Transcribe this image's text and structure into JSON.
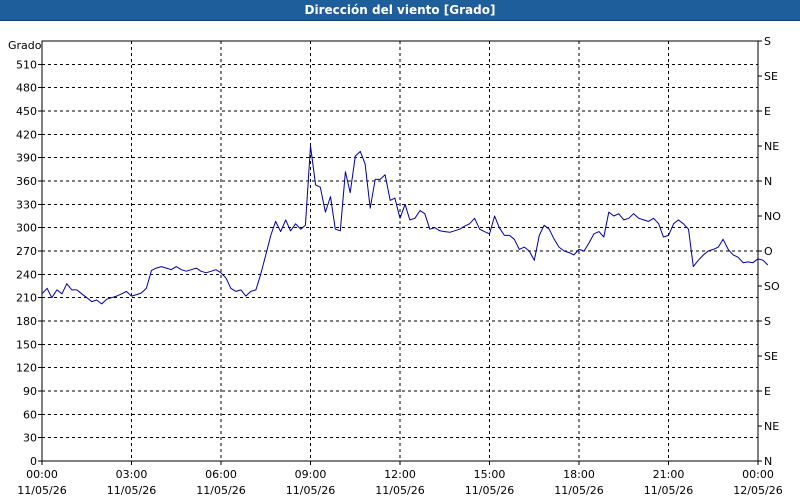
{
  "title": "Dirección del viento [Grado]",
  "chart_data": {
    "type": "line",
    "title": "Dirección del viento [Grado]",
    "ylabel": "Grado",
    "ylim": [
      0,
      540
    ],
    "yticks": [
      0,
      30,
      60,
      90,
      120,
      150,
      180,
      210,
      240,
      270,
      300,
      330,
      360,
      390,
      420,
      450,
      480,
      510
    ],
    "y2ticks": [
      {
        "v": 0,
        "label": "N"
      },
      {
        "v": 45,
        "label": "NE"
      },
      {
        "v": 90,
        "label": "E"
      },
      {
        "v": 135,
        "label": "SE"
      },
      {
        "v": 180,
        "label": "S"
      },
      {
        "v": 225,
        "label": "SO"
      },
      {
        "v": 270,
        "label": "O"
      },
      {
        "v": 315,
        "label": "NO"
      },
      {
        "v": 360,
        "label": "N"
      },
      {
        "v": 405,
        "label": "NE"
      },
      {
        "v": 450,
        "label": "E"
      },
      {
        "v": 495,
        "label": "SE"
      },
      {
        "v": 540,
        "label": "S"
      }
    ],
    "xlim": [
      0,
      24
    ],
    "xticks": [
      {
        "v": 0,
        "time": "00:00",
        "date": "11/05/26"
      },
      {
        "v": 3,
        "time": "03:00",
        "date": "11/05/26"
      },
      {
        "v": 6,
        "time": "06:00",
        "date": "11/05/26"
      },
      {
        "v": 9,
        "time": "09:00",
        "date": "11/05/26"
      },
      {
        "v": 12,
        "time": "12:00",
        "date": "11/05/26"
      },
      {
        "v": 15,
        "time": "15:00",
        "date": "11/05/26"
      },
      {
        "v": 18,
        "time": "18:00",
        "date": "11/05/26"
      },
      {
        "v": 21,
        "time": "21:00",
        "date": "11/05/26"
      },
      {
        "v": 24,
        "time": "00:00",
        "date": "12/05/26"
      }
    ],
    "grid": true,
    "series": [
      {
        "color": "#00009c",
        "points": [
          [
            0.0,
            215
          ],
          [
            0.17,
            222
          ],
          [
            0.33,
            210
          ],
          [
            0.5,
            220
          ],
          [
            0.67,
            215
          ],
          [
            0.83,
            228
          ],
          [
            1.0,
            220
          ],
          [
            1.17,
            220
          ],
          [
            1.33,
            215
          ],
          [
            1.5,
            210
          ],
          [
            1.67,
            205
          ],
          [
            1.83,
            207
          ],
          [
            2.0,
            202
          ],
          [
            2.17,
            208
          ],
          [
            2.33,
            210
          ],
          [
            2.5,
            212
          ],
          [
            2.67,
            215
          ],
          [
            2.83,
            218
          ],
          [
            3.0,
            212
          ],
          [
            3.17,
            214
          ],
          [
            3.33,
            216
          ],
          [
            3.5,
            222
          ],
          [
            3.67,
            245
          ],
          [
            3.83,
            248
          ],
          [
            4.0,
            250
          ],
          [
            4.17,
            248
          ],
          [
            4.33,
            246
          ],
          [
            4.5,
            250
          ],
          [
            4.67,
            246
          ],
          [
            4.83,
            244
          ],
          [
            5.0,
            246
          ],
          [
            5.17,
            248
          ],
          [
            5.33,
            244
          ],
          [
            5.5,
            242
          ],
          [
            5.67,
            244
          ],
          [
            5.83,
            246
          ],
          [
            6.0,
            242
          ],
          [
            6.17,
            235
          ],
          [
            6.33,
            222
          ],
          [
            6.5,
            218
          ],
          [
            6.67,
            220
          ],
          [
            6.83,
            212
          ],
          [
            7.0,
            218
          ],
          [
            7.17,
            220
          ],
          [
            7.33,
            240
          ],
          [
            7.5,
            265
          ],
          [
            7.67,
            290
          ],
          [
            7.83,
            308
          ],
          [
            8.0,
            295
          ],
          [
            8.17,
            310
          ],
          [
            8.33,
            296
          ],
          [
            8.5,
            305
          ],
          [
            8.67,
            298
          ],
          [
            8.83,
            303
          ],
          [
            9.0,
            405
          ],
          [
            9.17,
            355
          ],
          [
            9.33,
            352
          ],
          [
            9.5,
            320
          ],
          [
            9.67,
            340
          ],
          [
            9.83,
            298
          ],
          [
            10.0,
            296
          ],
          [
            10.17,
            372
          ],
          [
            10.33,
            345
          ],
          [
            10.5,
            392
          ],
          [
            10.67,
            398
          ],
          [
            10.83,
            382
          ],
          [
            11.0,
            325
          ],
          [
            11.17,
            362
          ],
          [
            11.33,
            362
          ],
          [
            11.5,
            368
          ],
          [
            11.67,
            335
          ],
          [
            11.83,
            338
          ],
          [
            12.0,
            312
          ],
          [
            12.17,
            330
          ],
          [
            12.33,
            310
          ],
          [
            12.5,
            312
          ],
          [
            12.67,
            322
          ],
          [
            12.83,
            318
          ],
          [
            13.0,
            298
          ],
          [
            13.17,
            300
          ],
          [
            13.33,
            296
          ],
          [
            13.5,
            295
          ],
          [
            13.67,
            294
          ],
          [
            13.83,
            296
          ],
          [
            14.0,
            298
          ],
          [
            14.17,
            302
          ],
          [
            14.33,
            305
          ],
          [
            14.5,
            312
          ],
          [
            14.67,
            298
          ],
          [
            14.83,
            295
          ],
          [
            15.0,
            292
          ],
          [
            15.17,
            315
          ],
          [
            15.33,
            300
          ],
          [
            15.5,
            290
          ],
          [
            15.67,
            290
          ],
          [
            15.83,
            285
          ],
          [
            16.0,
            272
          ],
          [
            16.17,
            275
          ],
          [
            16.33,
            270
          ],
          [
            16.5,
            258
          ],
          [
            16.67,
            290
          ],
          [
            16.83,
            303
          ],
          [
            17.0,
            298
          ],
          [
            17.17,
            285
          ],
          [
            17.33,
            275
          ],
          [
            17.5,
            270
          ],
          [
            17.67,
            268
          ],
          [
            17.83,
            265
          ],
          [
            18.0,
            272
          ],
          [
            18.17,
            270
          ],
          [
            18.33,
            280
          ],
          [
            18.5,
            292
          ],
          [
            18.67,
            295
          ],
          [
            18.83,
            288
          ],
          [
            19.0,
            320
          ],
          [
            19.17,
            315
          ],
          [
            19.33,
            318
          ],
          [
            19.5,
            310
          ],
          [
            19.67,
            312
          ],
          [
            19.83,
            318
          ],
          [
            20.0,
            312
          ],
          [
            20.17,
            310
          ],
          [
            20.33,
            308
          ],
          [
            20.5,
            312
          ],
          [
            20.67,
            305
          ],
          [
            20.83,
            288
          ],
          [
            21.0,
            290
          ],
          [
            21.17,
            305
          ],
          [
            21.33,
            310
          ],
          [
            21.5,
            305
          ],
          [
            21.67,
            298
          ],
          [
            21.83,
            250
          ],
          [
            22.0,
            258
          ],
          [
            22.17,
            265
          ],
          [
            22.33,
            270
          ],
          [
            22.5,
            272
          ],
          [
            22.67,
            275
          ],
          [
            22.83,
            285
          ],
          [
            23.0,
            272
          ],
          [
            23.17,
            265
          ],
          [
            23.33,
            262
          ],
          [
            23.5,
            255
          ],
          [
            23.67,
            256
          ],
          [
            23.83,
            255
          ],
          [
            24.0,
            260
          ],
          [
            24.17,
            258
          ],
          [
            24.33,
            252
          ]
        ]
      }
    ]
  }
}
